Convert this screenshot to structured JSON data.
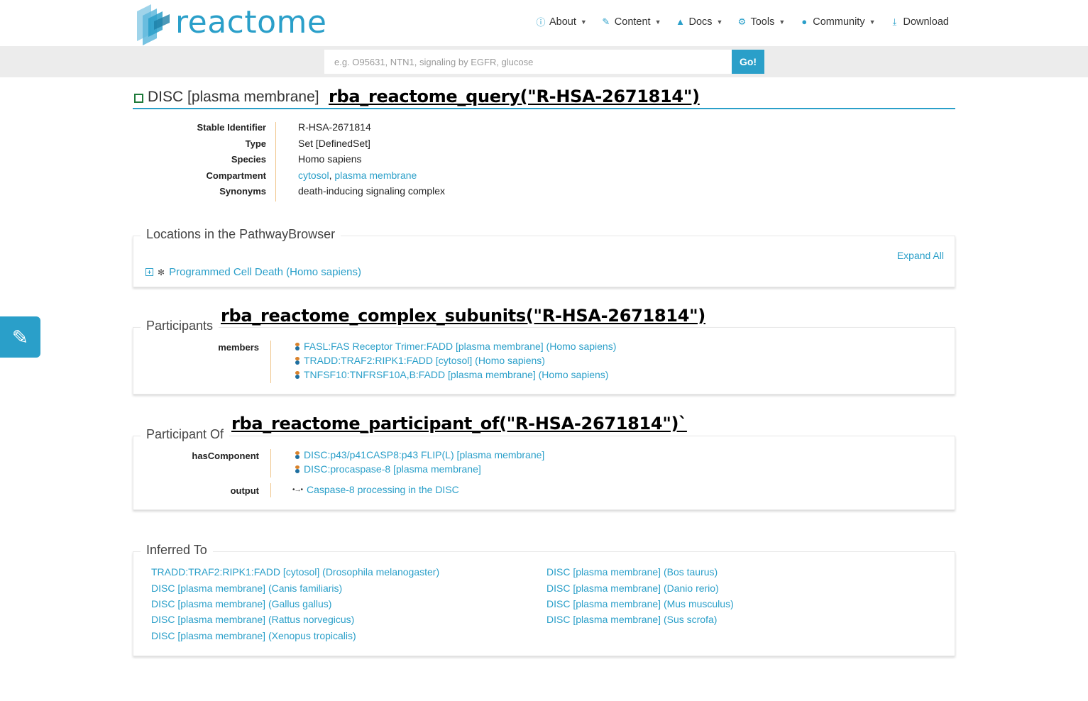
{
  "brand": {
    "name": "reactome",
    "accent": "#2a9fc9"
  },
  "nav": [
    {
      "label": "About",
      "icon": "info-circle-icon"
    },
    {
      "label": "Content",
      "icon": "edit-icon"
    },
    {
      "label": "Docs",
      "icon": "graduation-cap-icon"
    },
    {
      "label": "Tools",
      "icon": "cogs-icon"
    },
    {
      "label": "Community",
      "icon": "users-icon"
    },
    {
      "label": "Download",
      "icon": "download-icon"
    }
  ],
  "search": {
    "placeholder": "e.g. O95631, NTN1, signaling by EGFR, glucose",
    "value": "",
    "button": "Go!"
  },
  "title": "DISC [plasma membrane]",
  "annotations": {
    "query": "rba_reactome_query(\"R-HSA-2671814\")",
    "subunits": "rba_reactome_complex_subunits(\"R-HSA-2671814\")",
    "participant_of": "rba_reactome_participant_of(\"R-HSA-2671814\")`"
  },
  "details": {
    "stable_id_label": "Stable Identifier",
    "stable_id": "R-HSA-2671814",
    "type_label": "Type",
    "type": "Set [DefinedSet]",
    "species_label": "Species",
    "species": "Homo sapiens",
    "compartment_label": "Compartment",
    "compartment_1": "cytosol",
    "compartment_sep": ",",
    "compartment_2": "plasma membrane",
    "synonyms_label": "Synonyms",
    "synonyms": "death-inducing signaling complex"
  },
  "locations": {
    "title": "Locations in the PathwayBrowser",
    "expand_all": "Expand All",
    "pathway": "Programmed Cell Death (Homo sapiens)"
  },
  "participants": {
    "title": "Participants",
    "group_label": "members",
    "members": [
      "FASL:FAS Receptor Trimer:FADD [plasma membrane] (Homo sapiens)",
      "TRADD:TRAF2:RIPK1:FADD [cytosol] (Homo sapiens)",
      "TNFSF10:TNFRSF10A,B:FADD [plasma membrane] (Homo sapiens)"
    ]
  },
  "participant_of": {
    "title": "Participant Of",
    "has_component_label": "hasComponent",
    "has_component": [
      "DISC:p43/p41CASP8:p43 FLIP(L) [plasma membrane]",
      "DISC:procaspase-8 [plasma membrane]"
    ],
    "output_label": "output",
    "output": "Caspase-8 processing in the DISC"
  },
  "inferred_to": {
    "title": "Inferred To",
    "left": [
      "TRADD:TRAF2:RIPK1:FADD [cytosol] (Drosophila melanogaster)",
      "DISC [plasma membrane] (Canis familiaris)",
      "DISC [plasma membrane] (Gallus gallus)",
      "DISC [plasma membrane] (Rattus norvegicus)",
      "DISC [plasma membrane] (Xenopus tropicalis)"
    ],
    "right": [
      "DISC [plasma membrane] (Bos taurus)",
      "DISC [plasma membrane] (Danio rerio)",
      "DISC [plasma membrane] (Mus musculus)",
      "DISC [plasma membrane] (Sus scrofa)"
    ]
  }
}
